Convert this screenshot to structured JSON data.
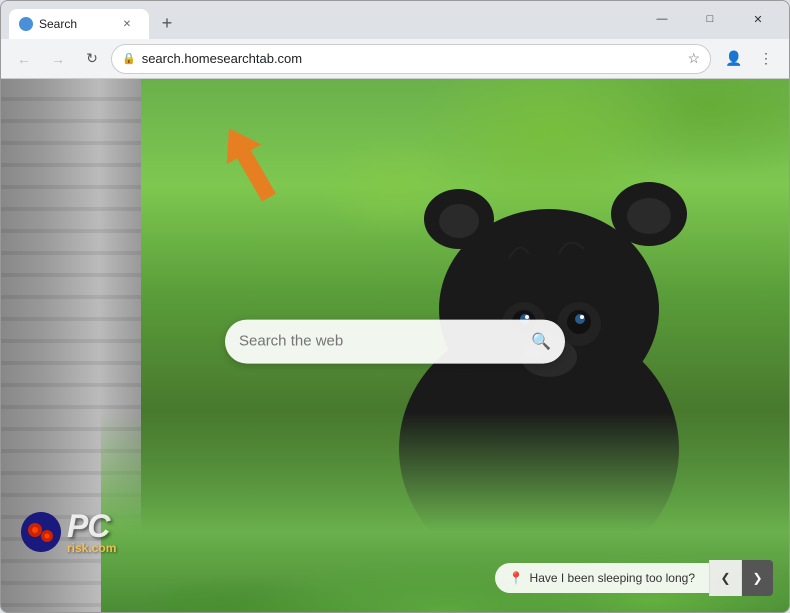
{
  "window": {
    "title": "Search",
    "controls": {
      "minimize": "—",
      "maximize": "□",
      "close": "✕"
    }
  },
  "tab": {
    "favicon_color": "#4a90d9",
    "title": "Search",
    "close": "✕",
    "new_tab": "+"
  },
  "navbar": {
    "back": "←",
    "forward": "→",
    "reload": "↻",
    "url": "search.homesearchtab.com",
    "url_placeholder": "search.homesearchtab.com",
    "bookmark": "☆",
    "profile": "👤",
    "menu": "⋮"
  },
  "search": {
    "placeholder": "Search the web",
    "icon": "🔍"
  },
  "pcrisk": {
    "text": "PC",
    "domain": "risk.com"
  },
  "suggestion": {
    "icon": "📍",
    "text": "Have I been sleeping too long?",
    "prev": "❮",
    "next": "❯"
  }
}
